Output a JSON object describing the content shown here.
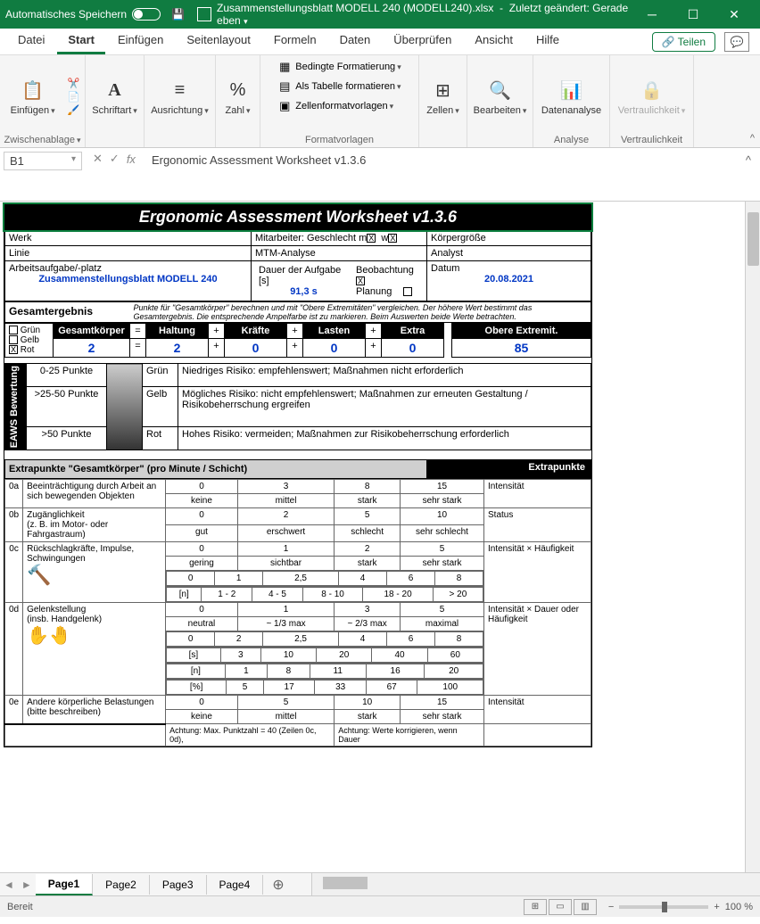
{
  "titlebar": {
    "autosave_label": "Automatisches Speichern",
    "filename": "Zusammenstellungsblatt MODELL 240 (MODELL240).xlsx",
    "modified": "Zuletzt geändert: Gerade eben"
  },
  "tabs": {
    "datei": "Datei",
    "start": "Start",
    "einfuegen": "Einfügen",
    "seitenlayout": "Seitenlayout",
    "formeln": "Formeln",
    "daten": "Daten",
    "ueberpruefen": "Überprüfen",
    "ansicht": "Ansicht",
    "hilfe": "Hilfe",
    "teilen": "Teilen"
  },
  "ribbon": {
    "einfuegen": "Einfügen",
    "zwischenablage": "Zwischenablage",
    "schriftart": "Schriftart",
    "ausrichtung": "Ausrichtung",
    "zahl": "Zahl",
    "bedingte": "Bedingte Formatierung",
    "als_tabelle": "Als Tabelle formatieren",
    "zellenformat": "Zellenformatvorlagen",
    "formatvorlagen": "Formatvorlagen",
    "zellen": "Zellen",
    "bearbeiten": "Bearbeiten",
    "datenanalyse": "Datenanalyse",
    "analyse": "Analyse",
    "vertraulichkeit": "Vertraulichkeit"
  },
  "cellref": {
    "name": "B1",
    "formula": "Ergonomic Assessment Worksheet  v1.3.6"
  },
  "doc": {
    "title": "Ergonomic Assessment Worksheet  v1.3.6",
    "werk": "Werk",
    "mitarbeiter": "Mitarbeiter: Geschlecht m",
    "w_lbl": "w",
    "koerper": "Körpergröße",
    "linie": "Linie",
    "mtm": "MTM-Analyse",
    "analyst": "Analyst",
    "aufgabe_lbl": "Arbeitsaufgabe/-platz",
    "aufgabe_val": "Zusammenstellungsblatt MODELL 240",
    "dauer_lbl": "Dauer der Aufgabe [s]",
    "dauer_val": "91,3 s",
    "beobachtung": "Beobachtung",
    "planung": "Planung",
    "datum_lbl": "Datum",
    "datum_val": "20.08.2021",
    "gesamt_hdr": "Gesamtergebnis",
    "gesamt_note": "Punkte für \"Gesamtkörper\" berechnen und mit \"Obere Extremitäten\" vergleichen. Der höhere Wert bestimmt das Gesamtergebnis. Die entsprechende Ampelfarbe ist zu markieren. Beim Auswerten beide Werte betrachten.",
    "gruen": "Grün",
    "gelb": "Gelb",
    "rot": "Rot",
    "h_gk": "Gesamtkörper",
    "h_haltung": "Haltung",
    "h_kraefte": "Kräfte",
    "h_lasten": "Lasten",
    "h_extra": "Extra",
    "h_obere": "Obere Extremit.",
    "v_gk": "2",
    "v_haltung": "2",
    "v_kraefte": "0",
    "v_lasten": "0",
    "v_extra": "0",
    "v_obere": "85",
    "eaws_lbl": "EAWS Bewertung",
    "r1_range": "0-25 Punkte",
    "r1_c": "Grün",
    "r1_txt": "Niedriges Risiko: empfehlenswert; Maßnahmen nicht erforderlich",
    "r2_range": ">25-50 Punkte",
    "r2_c": "Gelb",
    "r2_txt": "Mögliches Risiko: nicht empfehlenswert; Maßnahmen zur erneuten Gestaltung / Risikobeherrschung ergreifen",
    "r3_range": ">50 Punkte",
    "r3_c": "Rot",
    "r3_txt": "Hohes Risiko: vermeiden; Maßnahmen zur Risikobeherrschung erforderlich",
    "extra_hdr_l": "Extrapunkte \"Gesamtkörper\" (pro Minute / Schicht)",
    "extra_hdr_r": "Extrapunkte",
    "r0a_id": "0a",
    "r0a_lbl": "Beeinträchtigung durch Arbeit an sich bewegenden Objekten",
    "r0a_v": [
      "0",
      "3",
      "8",
      "15"
    ],
    "r0a_l": [
      "keine",
      "mittel",
      "stark",
      "sehr stark"
    ],
    "r0a_side": "Intensität",
    "r0b_id": "0b",
    "r0b_lbl": "Zugänglichkeit\n(z. B. im Motor- oder Fahrgastraum)",
    "r0b_v": [
      "0",
      "2",
      "5",
      "10"
    ],
    "r0b_l": [
      "gut",
      "erschwert",
      "schlecht",
      "sehr schlecht"
    ],
    "r0b_side": "Status",
    "r0c_id": "0c",
    "r0c_lbl": "Rückschlagkräfte, Impulse, Schwingungen",
    "r0c_v": [
      "0",
      "1",
      "2",
      "5"
    ],
    "r0c_l": [
      "gering",
      "sichtbar",
      "stark",
      "sehr stark"
    ],
    "r0c_v2": [
      "0",
      "1",
      "2,5",
      "4",
      "6",
      "8"
    ],
    "r0c_l2": [
      "[n]",
      "1 - 2",
      "4 - 5",
      "8 - 10",
      "18 - 20",
      "> 20"
    ],
    "r0c_side": "Intensität × Häufigkeit",
    "r0d_id": "0d",
    "r0d_lbl": "Gelenkstellung\n(insb. Handgelenk)",
    "r0d_v": [
      "0",
      "1",
      "3",
      "5"
    ],
    "r0d_l": [
      "neutral",
      "~ 1/3 max",
      "~ 2/3 max",
      "maximal"
    ],
    "r0d_v2": [
      "0",
      "2",
      "2,5",
      "4",
      "6",
      "8"
    ],
    "r0d_s": [
      "[s]",
      "3",
      "10",
      "20",
      "40",
      "60"
    ],
    "r0d_n": [
      "[n]",
      "1",
      "8",
      "11",
      "16",
      "20"
    ],
    "r0d_p": [
      "[%]",
      "5",
      "17",
      "33",
      "67",
      "100"
    ],
    "r0d_side": "Intensität × Dauer oder Häufigkeit",
    "r0e_id": "0e",
    "r0e_lbl": "Andere körperliche Belastungen (bitte beschreiben)",
    "r0e_v": [
      "0",
      "5",
      "10",
      "15"
    ],
    "r0e_l": [
      "keine",
      "mittel",
      "stark",
      "sehr stark"
    ],
    "r0e_side": "Intensität",
    "foot_note1": "Achtung: Max. Punktzahl = 40 (Zeilen 0c, 0d),",
    "foot_note2": "Achtung: Werte korrigieren, wenn Dauer"
  },
  "sheets": {
    "p1": "Page1",
    "p2": "Page2",
    "p3": "Page3",
    "p4": "Page4"
  },
  "status": {
    "ready": "Bereit",
    "zoom": "100 %"
  }
}
